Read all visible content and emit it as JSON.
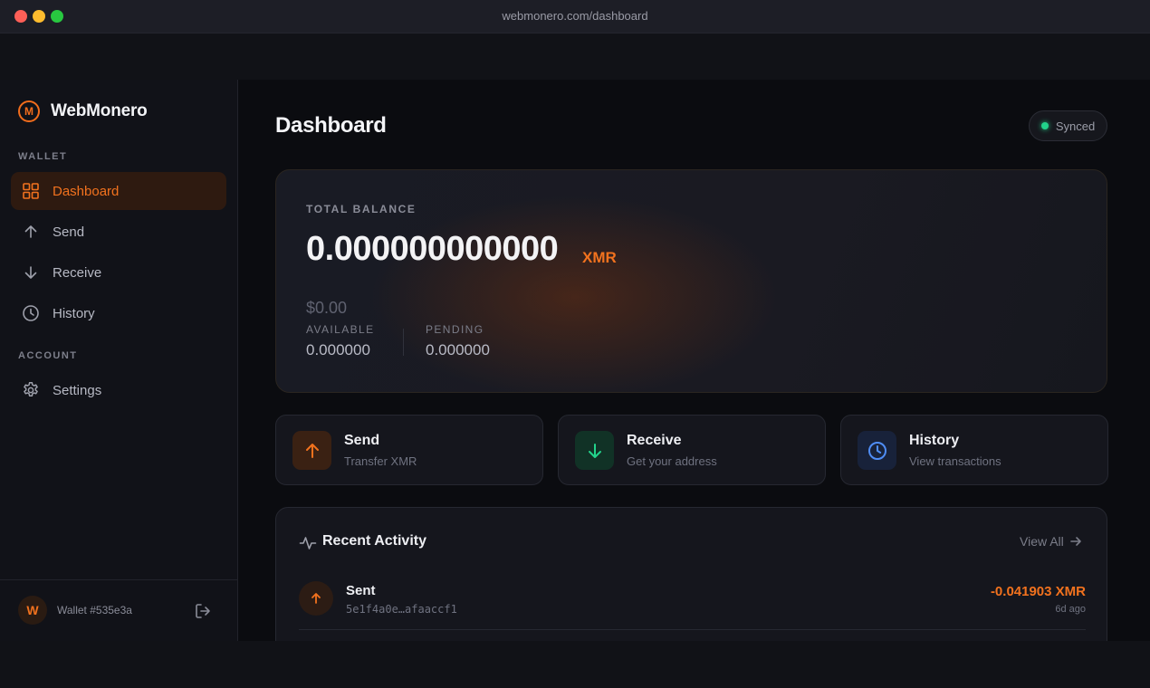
{
  "browser": {
    "url": "webmonero.com/dashboard"
  },
  "sidebar": {
    "brand": {
      "logo_letter": "M",
      "name": "WebMonero"
    },
    "wallet_section": "WALLET",
    "items": [
      {
        "label": "Dashboard",
        "icon": "grid-icon",
        "active": true
      },
      {
        "label": "Send",
        "icon": "arrow-up-icon"
      },
      {
        "label": "Receive",
        "icon": "arrow-down-icon"
      },
      {
        "label": "History",
        "icon": "clock-icon"
      }
    ],
    "account_section": "ACCOUNT",
    "account_items": [
      {
        "label": "Settings",
        "icon": "gear-icon"
      }
    ],
    "footer": {
      "avatar_letter": "W",
      "wallet_id": "Wallet #535e3a"
    }
  },
  "header": {
    "title": "Dashboard",
    "status": "Synced"
  },
  "balance": {
    "label": "TOTAL BALANCE",
    "amount": "0.000000000000",
    "unit": "XMR",
    "fiat": "$0.00",
    "available_label": "AVAILABLE",
    "available_value": "0.000000",
    "pending_label": "PENDING",
    "pending_value": "0.000000"
  },
  "actions": [
    {
      "title": "Send",
      "subtitle": "Transfer XMR"
    },
    {
      "title": "Receive",
      "subtitle": "Get your address"
    },
    {
      "title": "History",
      "subtitle": "View transactions"
    }
  ],
  "activity": {
    "title": "Recent Activity",
    "view_all": "View All",
    "transactions": [
      {
        "type": "Sent",
        "hash": "5e1f4a0e…afaaccf1",
        "amount": "-0.041903 XMR",
        "time": "6d ago"
      }
    ]
  },
  "colors": {
    "accent": "#f2721e",
    "success": "#22d38b",
    "info": "#4f8df5",
    "background": "#0b0c10"
  }
}
